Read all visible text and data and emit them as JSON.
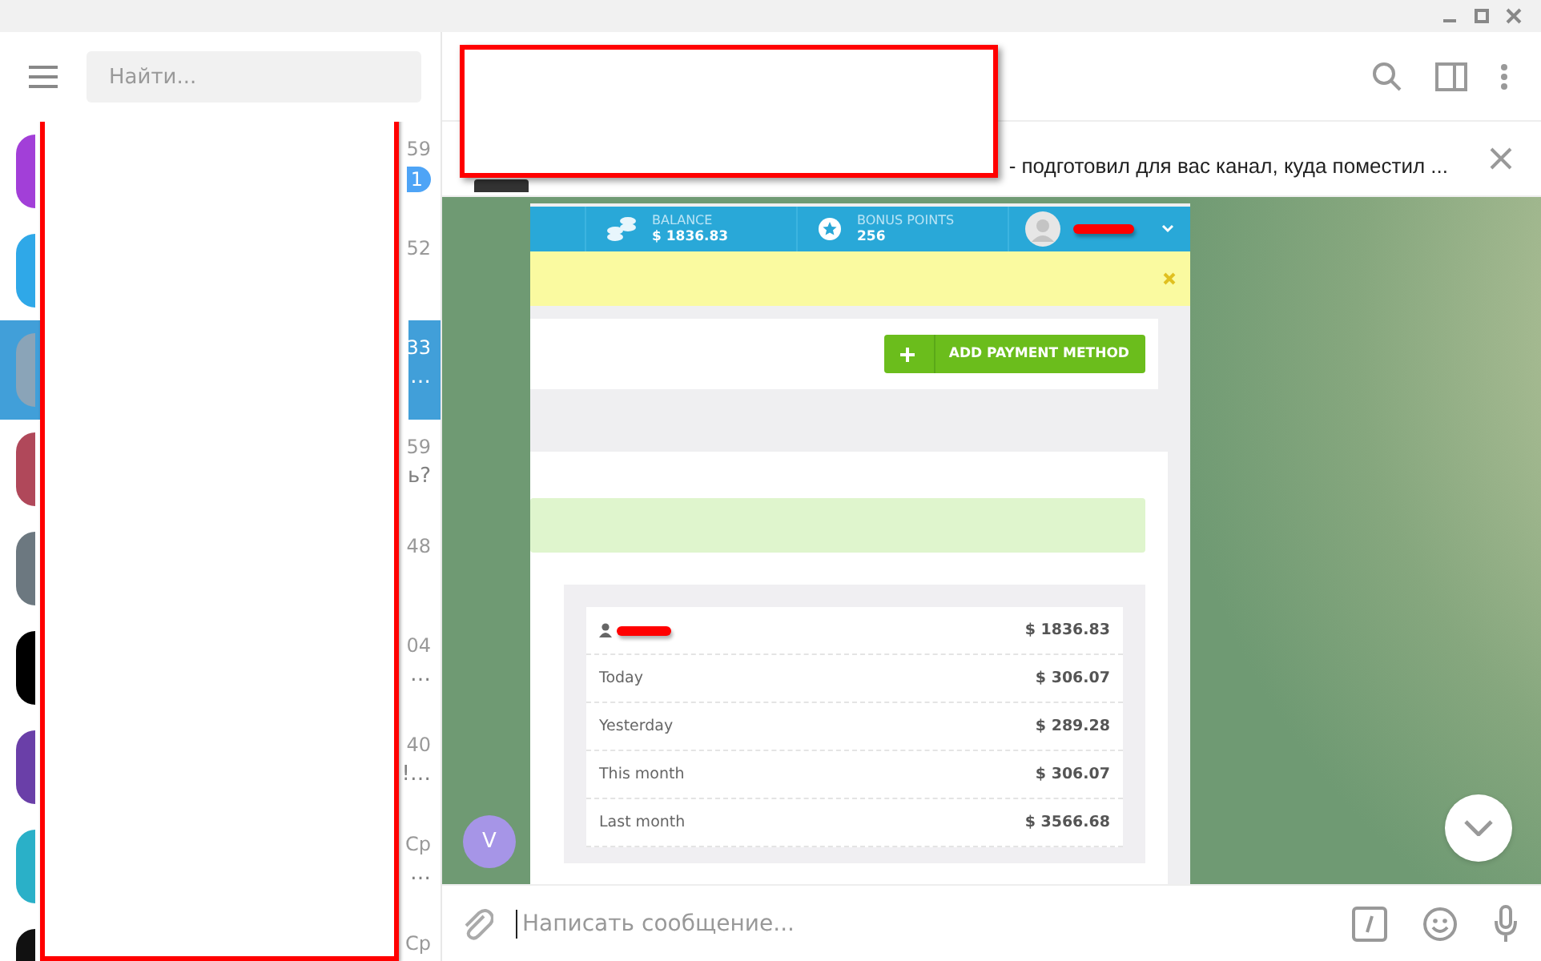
{
  "sidebar": {
    "search": {
      "placeholder": "Найти..."
    },
    "chats": [
      {
        "time": "59",
        "unread": "1",
        "selected": false
      },
      {
        "time": "52",
        "selected": false
      },
      {
        "time": "33",
        "preview": "…",
        "selected": true
      },
      {
        "time": "59",
        "preview": "ь?",
        "selected": false
      },
      {
        "time": "48",
        "selected": false
      },
      {
        "time": "04",
        "preview": "…",
        "selected": false
      },
      {
        "time": "40",
        "preview": "!…",
        "selected": false
      },
      {
        "time": "Ср",
        "preview": "…",
        "selected": false
      },
      {
        "time": "Ср",
        "selected": false
      }
    ]
  },
  "chat": {
    "pinned": {
      "text": "- подготовил для вас канал, куда поместил ..."
    },
    "message": {
      "sender_initial": "V",
      "screenshot": {
        "balance": {
          "label": "BALANCE",
          "value": "$ 1836.83"
        },
        "bonus": {
          "label": "BONUS POINTS",
          "value": "256"
        },
        "button": "ADD PAYMENT METHOD",
        "stats": [
          {
            "kind": "user",
            "value": "$ 1836.83"
          },
          {
            "kind": "period",
            "label": "Today",
            "value": "$ 306.07"
          },
          {
            "kind": "period",
            "label": "Yesterday",
            "value": "$ 289.28"
          },
          {
            "kind": "period",
            "label": "This month",
            "value": "$ 306.07"
          },
          {
            "kind": "period",
            "label": "Last month",
            "value": "$ 3566.68"
          }
        ]
      }
    },
    "composer": {
      "placeholder": "Написать сообщение..."
    }
  }
}
